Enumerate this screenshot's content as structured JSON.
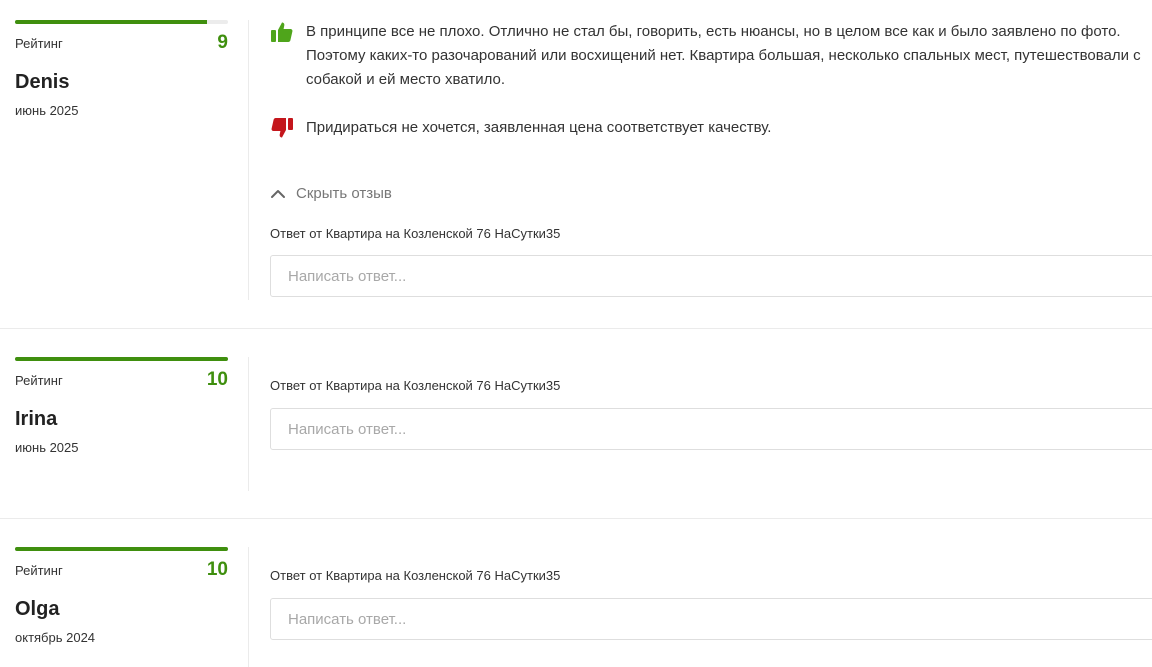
{
  "reviews": [
    {
      "rating_label": "Рейтинг",
      "score": "9",
      "score_fraction": 0.9,
      "author": "Denis",
      "date": "июнь 2025",
      "pro": "В принципе все не плохо. Отлично не стал бы, говорить, есть нюансы, но в целом все как и было заявлено по фото. Поэтому каких-то разочарований или восхищений нет. Квартира большая, несколько спальных мест, путешествовали с собакой и ей место хватило.",
      "con": "Придираться не хочется, заявленная цена соответствует качеству.",
      "hide_label": "Скрыть отзыв",
      "reply_label": "Ответ от Квартира на Козленской 76 НаСутки35",
      "reply_placeholder": "Написать ответ..."
    },
    {
      "rating_label": "Рейтинг",
      "score": "10",
      "score_fraction": 1.0,
      "author": "Irina",
      "date": "июнь 2025",
      "reply_label": "Ответ от Квартира на Козленской 76 НаСутки35",
      "reply_placeholder": "Написать ответ..."
    },
    {
      "rating_label": "Рейтинг",
      "score": "10",
      "score_fraction": 1.0,
      "author": "Olga",
      "date": "октябрь 2024",
      "reply_label": "Ответ от Квартира на Козленской 76 НаСутки35",
      "reply_placeholder": "Написать ответ..."
    }
  ],
  "icons": {
    "pro": "thumbs-up-icon",
    "con": "thumbs-down-icon",
    "hide": "chevron-up-icon"
  },
  "colors": {
    "accent_green": "#3f8f0e",
    "thumb_up": "#4fa51b",
    "thumb_down": "#c4161c",
    "bar_track": "#ececec"
  }
}
